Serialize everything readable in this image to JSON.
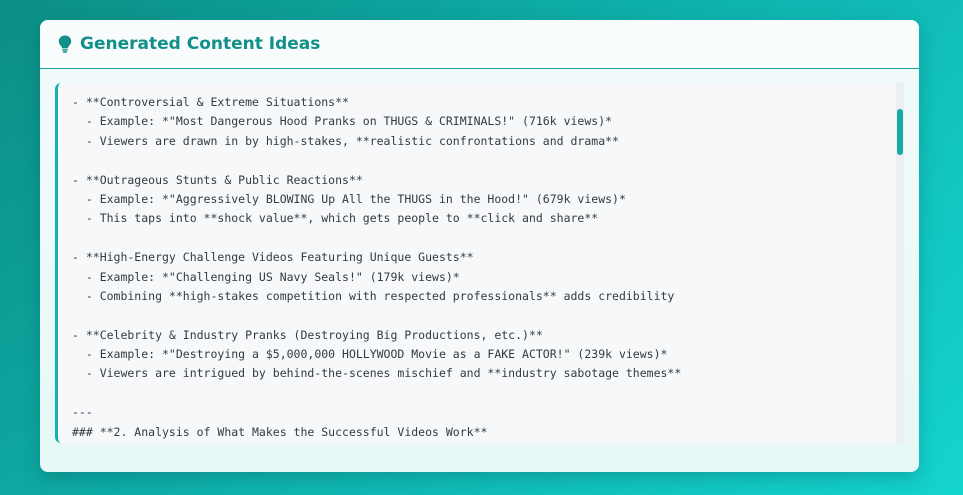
{
  "panel": {
    "title": "Generated Content Ideas",
    "icon": "lightbulb-icon",
    "accent_color": "#18a9a5"
  },
  "content_lines": [
    "- **Controversial & Extreme Situations**",
    "  - Example: *\"Most Dangerous Hood Pranks on THUGS & CRIMINALS!\" (716k views)*",
    "  - Viewers are drawn in by high-stakes, **realistic confrontations and drama**",
    "",
    "- **Outrageous Stunts & Public Reactions**",
    "  - Example: *\"Aggressively BLOWING Up All the THUGS in the Hood!\" (679k views)*",
    "  - This taps into **shock value**, which gets people to **click and share**",
    "",
    "- **High-Energy Challenge Videos Featuring Unique Guests**",
    "  - Example: *\"Challenging US Navy Seals!\" (179k views)*",
    "  - Combining **high-stakes competition with respected professionals** adds credibility",
    "",
    "- **Celebrity & Industry Pranks (Destroying Big Productions, etc.)**",
    "  - Example: *\"Destroying a $5,000,000 HOLLYWOOD Movie as a FAKE ACTOR!\" (239k views)*",
    "  - Viewers are intrigued by behind-the-scenes mischief and **industry sabotage themes**",
    "",
    "---",
    "### **2. Analysis of What Makes the Successful Videos Work**"
  ]
}
